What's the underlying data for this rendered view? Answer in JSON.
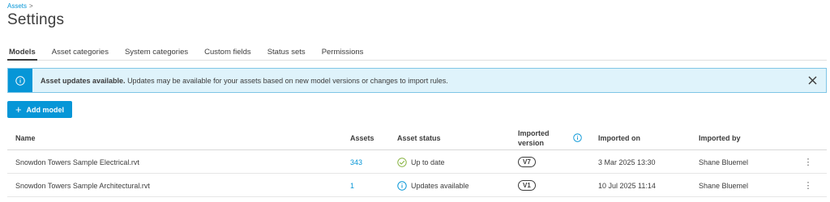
{
  "breadcrumb": {
    "parent": "Assets",
    "separator": ">"
  },
  "page": {
    "title": "Settings"
  },
  "tabs": [
    {
      "label": "Models",
      "active": true
    },
    {
      "label": "Asset categories",
      "active": false
    },
    {
      "label": "System categories",
      "active": false
    },
    {
      "label": "Custom fields",
      "active": false
    },
    {
      "label": "Status sets",
      "active": false
    },
    {
      "label": "Permissions",
      "active": false
    }
  ],
  "banner": {
    "title": "Asset updates available.",
    "message": "Updates may be available for your assets based on new model versions or changes to import rules."
  },
  "toolbar": {
    "add_label": "Add model"
  },
  "table": {
    "headers": {
      "name": "Name",
      "assets": "Assets",
      "status": "Asset status",
      "version_line1": "Imported",
      "version_line2": "version",
      "imported_on": "Imported on",
      "imported_by": "Imported by"
    },
    "rows": [
      {
        "name": "Snowdon Towers Sample Electrical.rvt",
        "assets": "343",
        "status": "Up to date",
        "status_icon": "check-circle-icon",
        "version": "V7",
        "imported_on": "3 Mar 2025 13:30",
        "imported_by": "Shane Bluemel"
      },
      {
        "name": "Snowdon Towers Sample Architectural.rvt",
        "assets": "1",
        "status": "Updates available",
        "status_icon": "info-circle-icon",
        "version": "V1",
        "imported_on": "10 Jul 2025 11:14",
        "imported_by": "Shane Bluemel"
      }
    ]
  },
  "colors": {
    "accent": "#0696d7",
    "banner_bg": "#dff3fb",
    "banner_border": "#7fc5e6",
    "success": "#87b340"
  }
}
